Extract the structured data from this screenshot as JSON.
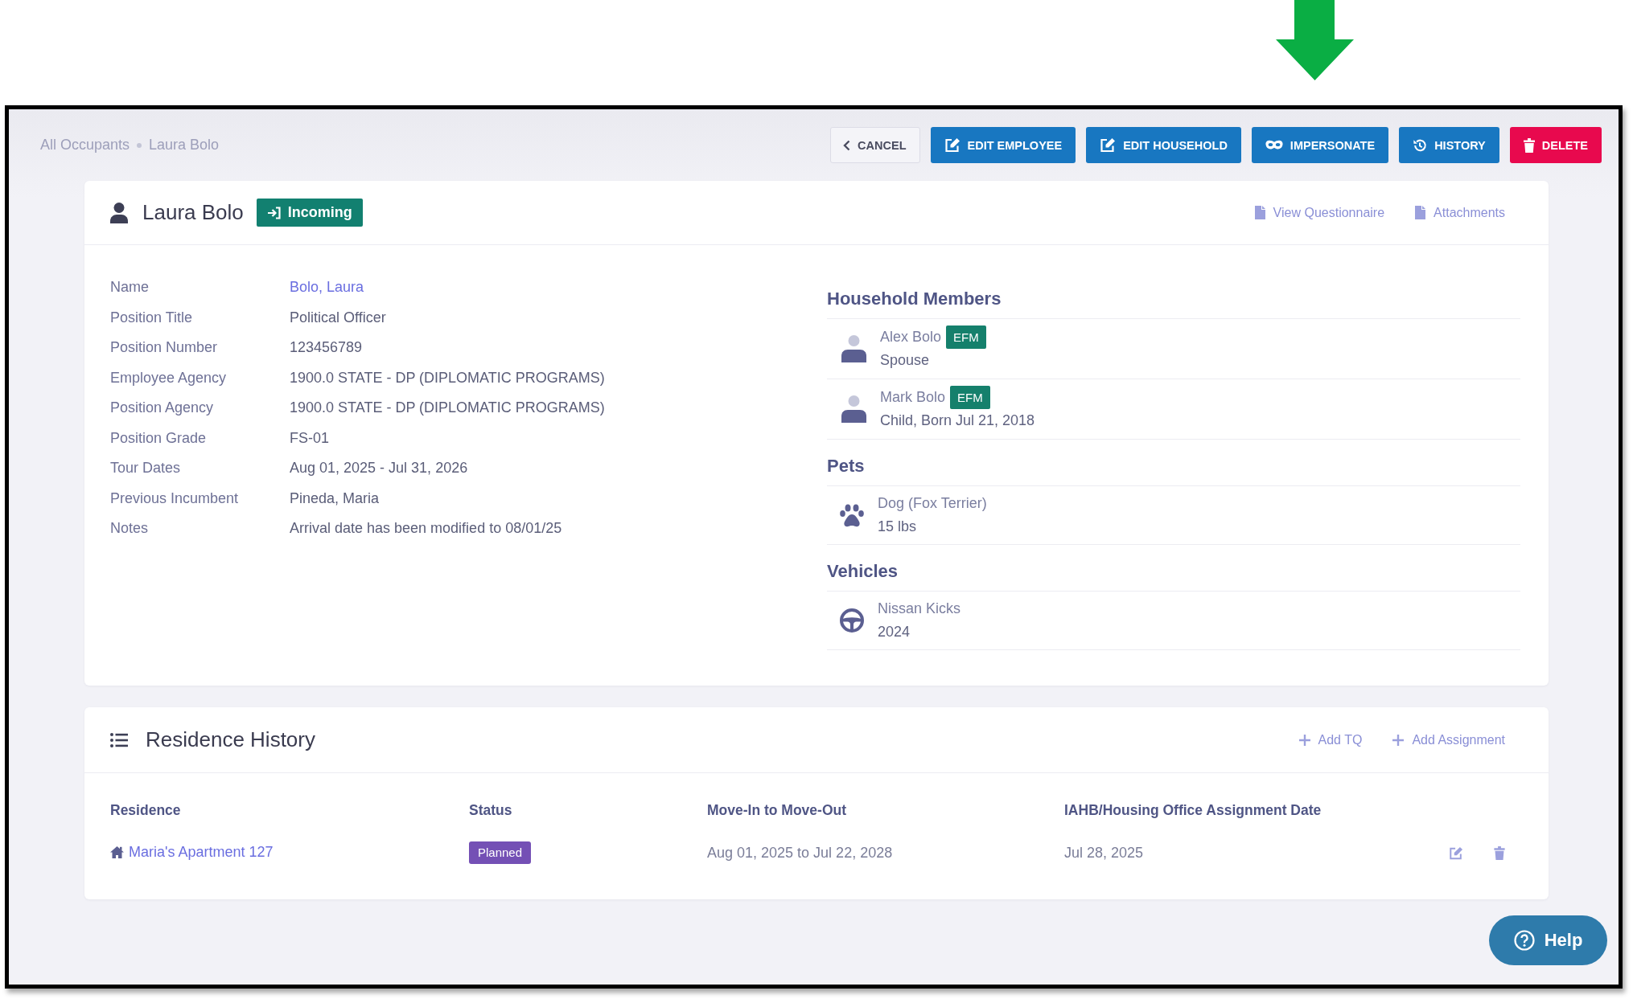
{
  "breadcrumb": [
    {
      "label": "All Occupants"
    },
    {
      "label": "Laura Bolo"
    }
  ],
  "toolbar": [
    {
      "label": "CANCEL",
      "kind": "back"
    },
    {
      "label": "EDIT EMPLOYEE",
      "kind": "edit"
    },
    {
      "label": "EDIT HOUSEHOLD",
      "kind": "edit"
    },
    {
      "label": "IMPERSONATE",
      "kind": "impersonate"
    },
    {
      "label": "HISTORY",
      "kind": "history"
    },
    {
      "label": "DELETE",
      "kind": "delete"
    }
  ],
  "profile": {
    "name": "Laura Bolo",
    "status": "Incoming",
    "links": [
      {
        "label": "View Questionnaire"
      },
      {
        "label": "Attachments"
      }
    ],
    "details": [
      {
        "label": "Name",
        "value": "Bolo, Laura",
        "kind": "link"
      },
      {
        "label": "Position Title",
        "value": "Political Officer",
        "kind": "text"
      },
      {
        "label": "Position Number",
        "value": "123456789",
        "kind": "text"
      },
      {
        "label": "Employee Agency",
        "value": "1900.0 STATE - DP (DIPLOMATIC PROGRAMS)",
        "kind": "text"
      },
      {
        "label": "Position Agency",
        "value": "1900.0 STATE - DP (DIPLOMATIC PROGRAMS)",
        "kind": "text"
      },
      {
        "label": "Position Grade",
        "value": "FS-01",
        "kind": "text"
      },
      {
        "label": "Tour Dates",
        "value": "Aug 01, 2025 - Jul 31, 2026",
        "kind": "text"
      },
      {
        "label": "Previous Incumbent",
        "value": "Pineda, Maria",
        "kind": "text"
      },
      {
        "label": "Notes",
        "value": "Arrival date has been modified to 08/01/25",
        "kind": "text"
      }
    ]
  },
  "household": [
    {
      "title": "Household Members",
      "kind": "person",
      "items": [
        {
          "name": "Alex Bolo",
          "badge": "EFM",
          "subtitle": "Spouse"
        },
        {
          "name": "Mark Bolo",
          "badge": "EFM",
          "subtitle": "Child, Born Jul 21, 2018"
        }
      ]
    },
    {
      "title": "Pets",
      "kind": "pet",
      "items": [
        {
          "name": "Dog (Fox Terrier)",
          "subtitle": "15 lbs"
        }
      ]
    },
    {
      "title": "Vehicles",
      "kind": "vehicle",
      "items": [
        {
          "name": "Nissan Kicks",
          "subtitle": "2024"
        }
      ]
    }
  ],
  "residence_history": {
    "title": "Residence History",
    "actions": [
      {
        "label": "Add TQ"
      },
      {
        "label": "Add Assignment"
      }
    ],
    "table": {
      "columns": [
        "Residence",
        "Status",
        "Move-In to Move-Out",
        "IAHB/Housing Office Assignment Date"
      ],
      "rows": [
        {
          "residence": "Maria's Apartment 127",
          "status": "Planned",
          "period": "Aug 01, 2025 to Jul 22, 2028",
          "assignment_date": "Jul 28, 2025"
        }
      ]
    }
  },
  "help_button": {
    "label": "Help"
  }
}
